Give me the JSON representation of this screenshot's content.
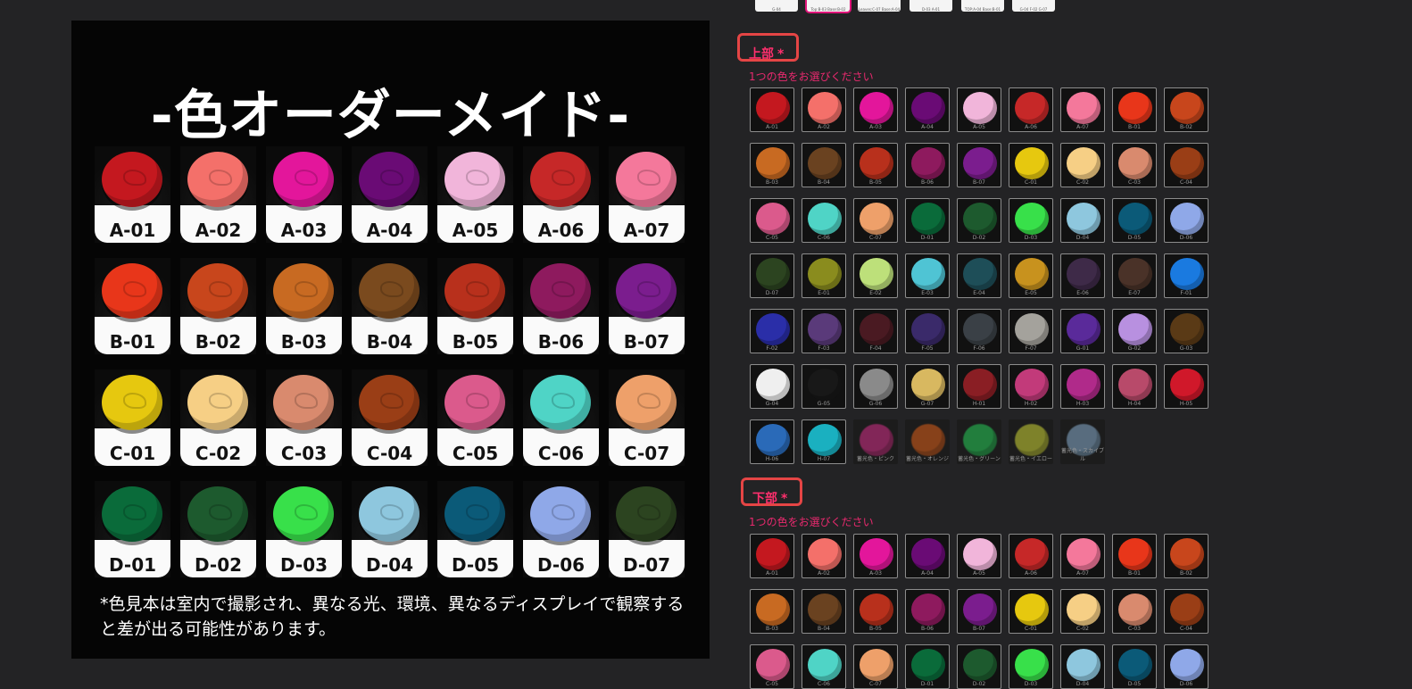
{
  "image": {
    "title": "-色オーダーメイド-",
    "note": "*色見本は室内で撮影され、異なる光、環境、異なるディスプレイで観察すると差が出る可能性があります。",
    "swatches": [
      {
        "code": "A-01",
        "color": "#c4181f"
      },
      {
        "code": "A-02",
        "color": "#f4706a"
      },
      {
        "code": "A-03",
        "color": "#e3169b"
      },
      {
        "code": "A-04",
        "color": "#6a0b75"
      },
      {
        "code": "A-05",
        "color": "#f1b5da"
      },
      {
        "code": "A-06",
        "color": "#c62828"
      },
      {
        "code": "A-07",
        "color": "#f4789b"
      },
      {
        "code": "B-01",
        "color": "#e8361a"
      },
      {
        "code": "B-02",
        "color": "#c8461c"
      },
      {
        "code": "B-03",
        "color": "#c86a22"
      },
      {
        "code": "B-04",
        "color": "#7a4a1e"
      },
      {
        "code": "B-05",
        "color": "#b8301c"
      },
      {
        "code": "B-06",
        "color": "#8e1a5e"
      },
      {
        "code": "B-07",
        "color": "#7b1d8e"
      },
      {
        "code": "C-01",
        "color": "#e6c80f"
      },
      {
        "code": "C-02",
        "color": "#f6cf85"
      },
      {
        "code": "C-03",
        "color": "#d98a6e"
      },
      {
        "code": "C-04",
        "color": "#9a3e16"
      },
      {
        "code": "C-05",
        "color": "#db5a8c"
      },
      {
        "code": "C-06",
        "color": "#4fd4c6"
      },
      {
        "code": "C-07",
        "color": "#eea06a"
      },
      {
        "code": "D-01",
        "color": "#0a6b3a"
      },
      {
        "code": "D-02",
        "color": "#1d5a2e"
      },
      {
        "code": "D-03",
        "color": "#38e04a"
      },
      {
        "code": "D-04",
        "color": "#8ec7de"
      },
      {
        "code": "D-05",
        "color": "#0b5a78"
      },
      {
        "code": "D-06",
        "color": "#8fa8e8"
      },
      {
        "code": "D-07",
        "color": "#2c4420"
      }
    ]
  },
  "top_thumbs": [
    {
      "label": "G-04",
      "selected": false
    },
    {
      "label": "Top:B-03 Base:B-02",
      "selected": true
    },
    {
      "label": "Leaves:C-07 Base:A-04",
      "selected": false
    },
    {
      "label": "D-03 A-01",
      "selected": false
    },
    {
      "label": "TOP:A-04 Base:B-01",
      "selected": false
    },
    {
      "label": "G-04 F-02 G-07",
      "selected": false
    }
  ],
  "sections": [
    {
      "label": "上部",
      "required": "*",
      "hint": "1つの色をお選びください"
    },
    {
      "label": "下部",
      "required": "*",
      "hint": "1つの色をお選びください"
    }
  ],
  "options": [
    {
      "code": "A-01",
      "color": "#c4181f"
    },
    {
      "code": "A-02",
      "color": "#f4706a"
    },
    {
      "code": "A-03",
      "color": "#e3169b"
    },
    {
      "code": "A-04",
      "color": "#6a0b75"
    },
    {
      "code": "A-05",
      "color": "#f1b5da"
    },
    {
      "code": "A-06",
      "color": "#c62828"
    },
    {
      "code": "A-07",
      "color": "#f4789b"
    },
    {
      "code": "B-01",
      "color": "#e8361a"
    },
    {
      "code": "B-02",
      "color": "#c8461c"
    },
    {
      "code": "B-03",
      "color": "#c86a22"
    },
    {
      "code": "B-04",
      "color": "#6a4220"
    },
    {
      "code": "B-05",
      "color": "#b8301c"
    },
    {
      "code": "B-06",
      "color": "#8e1a5e"
    },
    {
      "code": "B-07",
      "color": "#7b1d8e"
    },
    {
      "code": "C-01",
      "color": "#e6c80f"
    },
    {
      "code": "C-02",
      "color": "#f6cf85"
    },
    {
      "code": "C-03",
      "color": "#d98a6e"
    },
    {
      "code": "C-04",
      "color": "#9a3e16"
    },
    {
      "code": "C-05",
      "color": "#db5a8c"
    },
    {
      "code": "C-06",
      "color": "#4fd4c6"
    },
    {
      "code": "C-07",
      "color": "#eea06a"
    },
    {
      "code": "D-01",
      "color": "#0a6b3a"
    },
    {
      "code": "D-02",
      "color": "#1d5a2e"
    },
    {
      "code": "D-03",
      "color": "#38e04a"
    },
    {
      "code": "D-04",
      "color": "#8ec7de"
    },
    {
      "code": "D-05",
      "color": "#0b5a78"
    },
    {
      "code": "D-06",
      "color": "#8fa8e8"
    },
    {
      "code": "D-07",
      "color": "#2c4420"
    },
    {
      "code": "E-01",
      "color": "#8a8c1e"
    },
    {
      "code": "E-02",
      "color": "#bde07a"
    },
    {
      "code": "E-03",
      "color": "#4fc4d4"
    },
    {
      "code": "E-04",
      "color": "#1e4e58"
    },
    {
      "code": "E-05",
      "color": "#c8921e"
    },
    {
      "code": "E-06",
      "color": "#3e2a48"
    },
    {
      "code": "E-07",
      "color": "#4a3228"
    },
    {
      "code": "F-01",
      "color": "#1a7ae0"
    },
    {
      "code": "F-02",
      "color": "#2a2ea8"
    },
    {
      "code": "F-03",
      "color": "#5a3a7a"
    },
    {
      "code": "F-04",
      "color": "#4a1a22"
    },
    {
      "code": "F-05",
      "color": "#3a2a6a"
    },
    {
      "code": "F-06",
      "color": "#3a4046"
    },
    {
      "code": "F-07",
      "color": "#a4a29c"
    },
    {
      "code": "G-01",
      "color": "#5a2a9a"
    },
    {
      "code": "G-02",
      "color": "#b890e0"
    },
    {
      "code": "G-03",
      "color": "#5a3a16"
    },
    {
      "code": "G-04",
      "color": "#efefef"
    },
    {
      "code": "G-05",
      "color": "#181818"
    },
    {
      "code": "G-06",
      "color": "#8a8a8a"
    },
    {
      "code": "G-07",
      "color": "#d8b860"
    },
    {
      "code": "H-01",
      "color": "#8a1e24"
    },
    {
      "code": "H-02",
      "color": "#c23a7a"
    },
    {
      "code": "H-03",
      "color": "#b02a8a"
    },
    {
      "code": "H-04",
      "color": "#b84a6a"
    },
    {
      "code": "H-05",
      "color": "#d0182a"
    },
    {
      "code": "H-06",
      "color": "#2a6ab8"
    },
    {
      "code": "H-07",
      "color": "#1ab0c0"
    },
    {
      "code": "蓄光色・ピンク",
      "color": "#d8308a",
      "soft": true
    },
    {
      "code": "蓄光色・オレンジ",
      "color": "#e0621a",
      "soft": true
    },
    {
      "code": "蓄光色・グリーン",
      "color": "#28d05a",
      "soft": true
    },
    {
      "code": "蓄光色・イエロー",
      "color": "#d0d838",
      "soft": true
    },
    {
      "code": "蓄光色・スカイブル",
      "color": "#8ab0d0",
      "soft": true
    }
  ]
}
